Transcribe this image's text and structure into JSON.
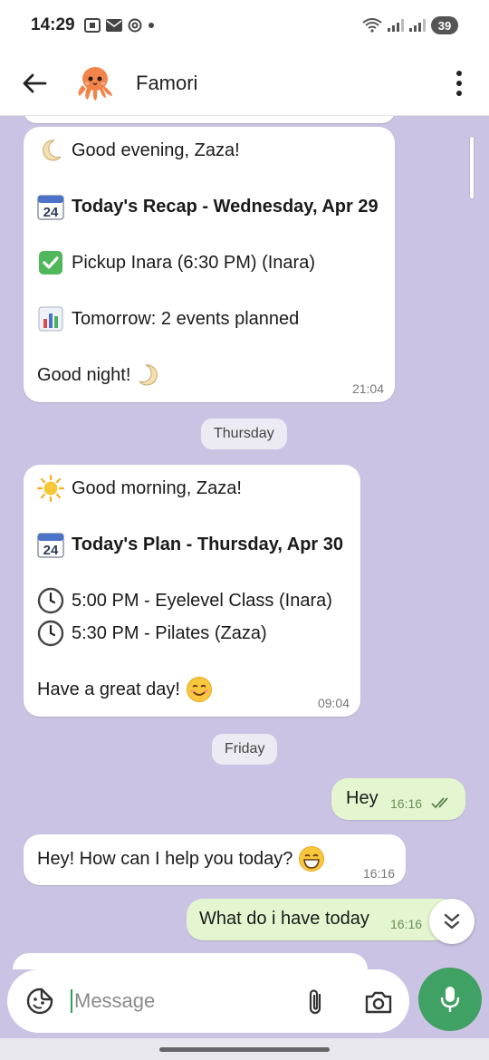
{
  "status": {
    "time": "14:29",
    "battery": "39"
  },
  "header": {
    "contact_name": "Famori"
  },
  "messages": {
    "recap": {
      "greeting": "Good evening, Zaza!",
      "title": "Today's Recap - Wednesday, Apr 29",
      "pickup": "Pickup Inara (6:30 PM) (Inara)",
      "tomorrow": "Tomorrow: 2 events planned",
      "closing": "Good night!",
      "time": "21:04"
    },
    "date_thursday": "Thursday",
    "plan": {
      "greeting": "Good morning, Zaza!",
      "title": "Today's Plan - Thursday, Apr 30",
      "event1": "5:00 PM - Eyelevel Class (Inara)",
      "event2": "5:30 PM - Pilates (Zaza)",
      "closing": "Have a great day!",
      "time": "09:04"
    },
    "date_friday": "Friday",
    "out1": {
      "text": "Hey",
      "time": "16:16"
    },
    "in1": {
      "text": "Hey! How can I help you today?",
      "time": "16:16"
    },
    "out2": {
      "text": "What do i have today",
      "time": "16:16"
    }
  },
  "input": {
    "placeholder": "Message"
  },
  "colors": {
    "chat_background": "#cbc3e3",
    "outgoing_bubble": "#e3f6cf",
    "mic_button": "#3fa163"
  }
}
